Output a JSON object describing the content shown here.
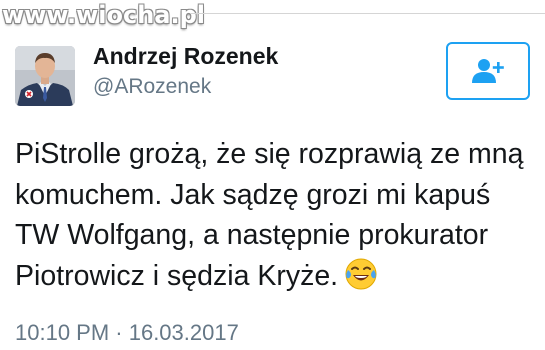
{
  "watermark": {
    "text": "www.wiocha.pl"
  },
  "user": {
    "display_name": "Andrzej Rozenek",
    "handle": "@ARozenek"
  },
  "follow_button": {
    "icon": "add-user-icon"
  },
  "tweet": {
    "lines": [
      "PiStrolle grożą, że się rozprawią ze mną",
      "komuchem. Jak sądzę grozi mi kapuś",
      "TW Wolfgang, a następnie prokurator",
      "Piotrowicz i sędzia Kryże."
    ],
    "emoji": "face-with-tears-of-joy"
  },
  "meta": {
    "timestamp": "10:10 PM · 16.03.2017"
  },
  "colors": {
    "accent": "#1da1f2",
    "text": "#14171a",
    "secondary": "#657786"
  }
}
